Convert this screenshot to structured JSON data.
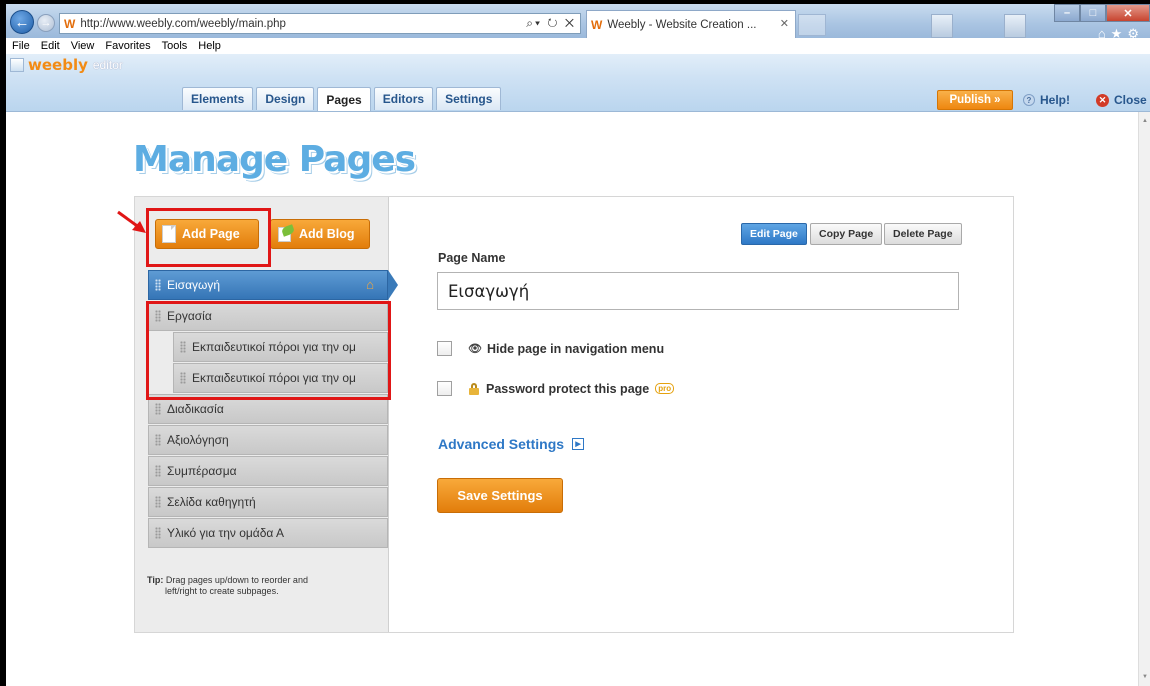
{
  "browser": {
    "url": "http://www.weebly.com/weebly/main.php",
    "url_host_bold": "weebly.com",
    "tab_title": "Weebly - Website Creation ...",
    "menu": [
      "File",
      "Edit",
      "View",
      "Favorites",
      "Tools",
      "Help"
    ]
  },
  "toolbar": {
    "logo": "weebly",
    "logo_suffix": "editor",
    "tabs": [
      "Elements",
      "Design",
      "Pages",
      "Editors",
      "Settings"
    ],
    "active_tab": "Pages",
    "publish_label": "Publish »",
    "help_label": "Help!",
    "close_label": "Close"
  },
  "page_title": "Manage Pages",
  "sidebar": {
    "add_page_label": "Add Page",
    "add_blog_label": "Add Blog",
    "pages": [
      {
        "label": "Εισαγωγή",
        "selected": true,
        "home": true
      },
      {
        "label": "Εργασία"
      },
      {
        "label": "Εκπαιδευτικοί πόροι για την ομ",
        "sub": true
      },
      {
        "label": "Εκπαιδευτικοί πόροι για την ομ",
        "sub": true
      },
      {
        "label": "Διαδικασία"
      },
      {
        "label": "Αξιολόγηση"
      },
      {
        "label": "Συμπέρασμα"
      },
      {
        "label": "Σελίδα καθηγητή"
      },
      {
        "label": "Υλικό για την ομάδα Α"
      }
    ],
    "tip_label": "Tip:",
    "tip_line1": "Drag pages up/down to reorder and",
    "tip_line2": "left/right to create subpages."
  },
  "editor": {
    "edit_page_label": "Edit Page",
    "copy_page_label": "Copy Page",
    "delete_page_label": "Delete Page",
    "page_name_label": "Page Name",
    "page_name_value": "Εισαγωγή",
    "hide_label": "Hide page in navigation menu",
    "password_label": "Password protect this page",
    "pro_badge": "pro",
    "advanced_label": "Advanced Settings",
    "save_label": "Save Settings"
  },
  "colors": {
    "accent_orange": "#ee8710",
    "selected_blue": "#3575b6",
    "annotation_red": "#e01616",
    "title_blue": "#5dade2"
  }
}
